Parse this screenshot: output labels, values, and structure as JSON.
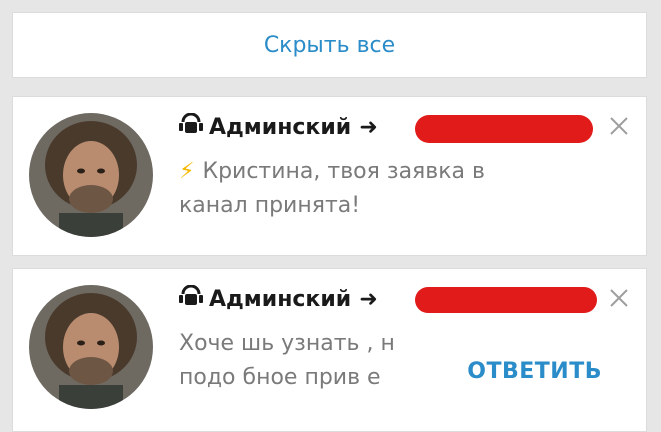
{
  "hide_all": {
    "label": "Скрыть все"
  },
  "notifications": [
    {
      "sender": "Админский",
      "message": "Кристина, твоя заявка в канал принята!",
      "prefix_icon": "lightning-icon",
      "close_icon": "close-icon"
    },
    {
      "sender": "Админский",
      "message": "Хоче шь узнать , н подо бное прив е",
      "reply_label": "ОТВЕТИТЬ",
      "close_icon": "close-icon"
    }
  ],
  "colors": {
    "accent": "#2a8cc8",
    "redaction": "#e11a1a",
    "message_text": "#7a7a7a"
  }
}
